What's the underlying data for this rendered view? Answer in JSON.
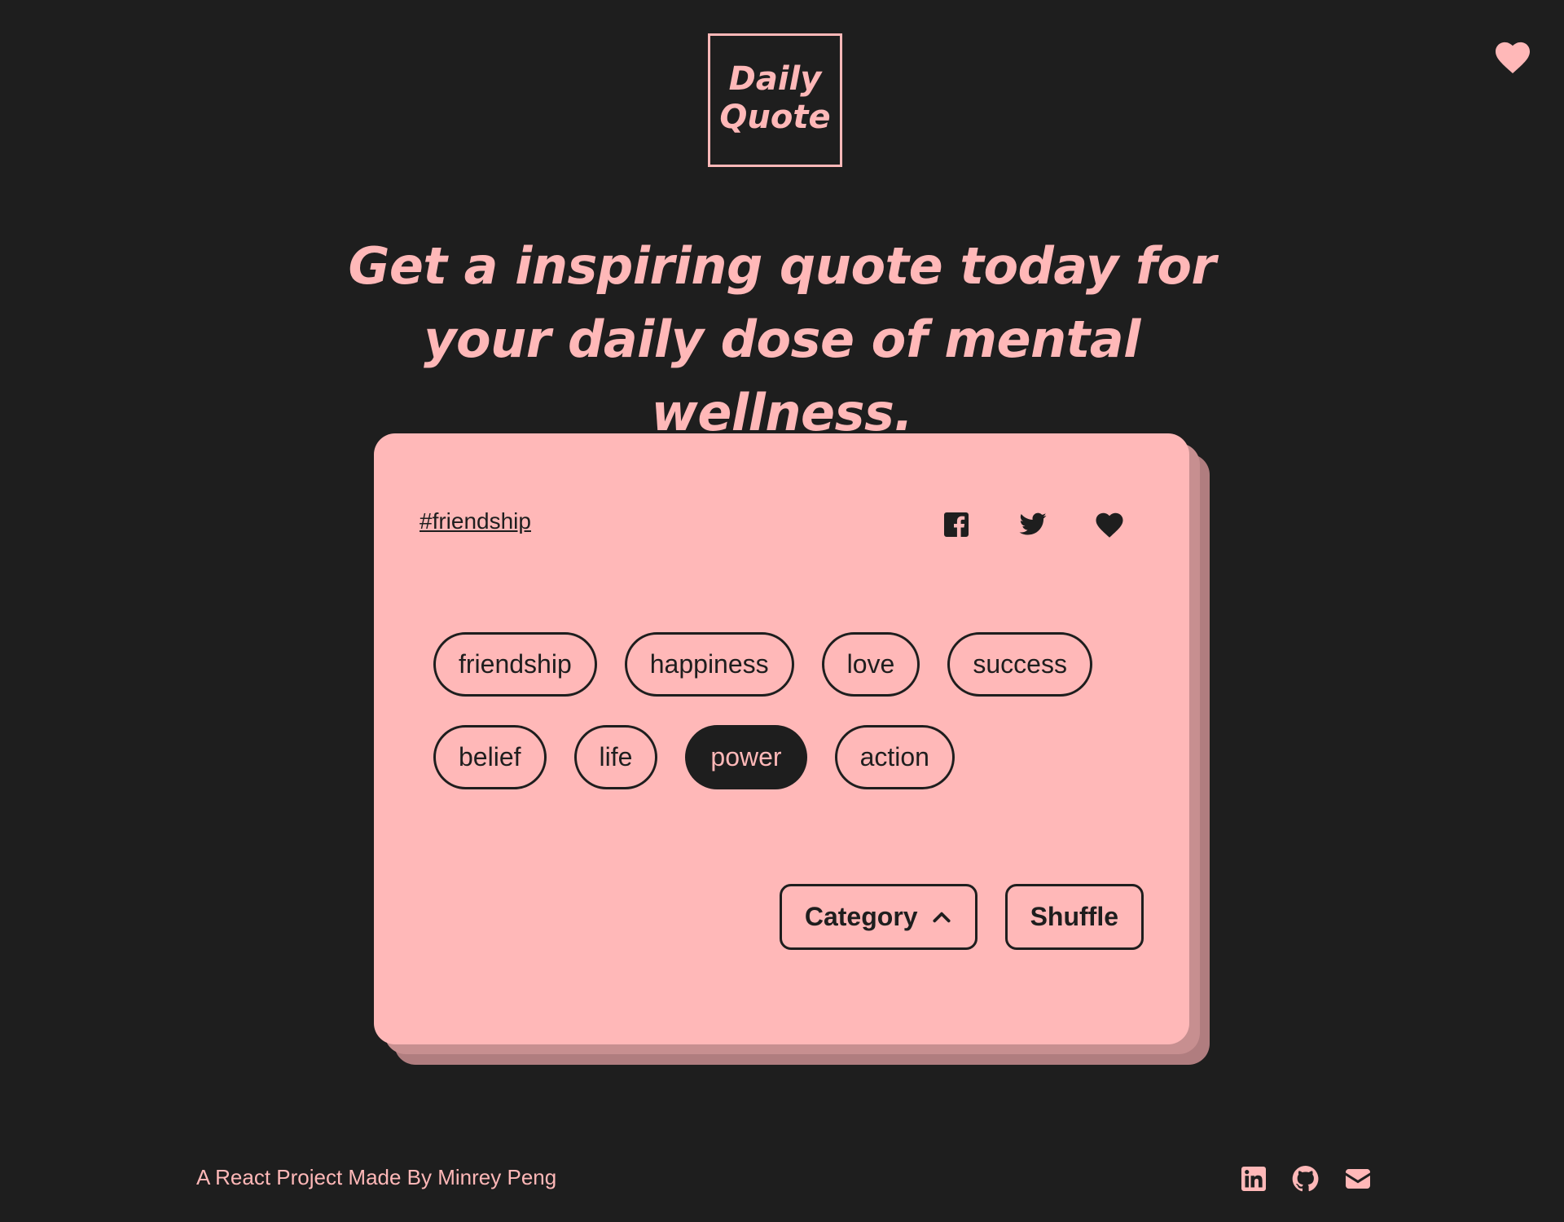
{
  "header": {
    "logo_text": "Daily\nQuote",
    "favorites_icon": "heart-icon"
  },
  "hero": {
    "headline": "Get a inspiring quote today for your daily dose of mental wellness."
  },
  "card": {
    "current_tag": "#friendship",
    "share_icons": [
      "facebook-icon",
      "twitter-icon",
      "heart-icon"
    ],
    "categories": [
      {
        "label": "friendship",
        "selected": false
      },
      {
        "label": "happiness",
        "selected": false
      },
      {
        "label": "love",
        "selected": false
      },
      {
        "label": "success",
        "selected": false
      },
      {
        "label": "belief",
        "selected": false
      },
      {
        "label": "life",
        "selected": false
      },
      {
        "label": "power",
        "selected": true
      },
      {
        "label": "action",
        "selected": false
      }
    ],
    "category_button_label": "Category",
    "category_button_icon": "chevron-up-icon",
    "shuffle_button_label": "Shuffle"
  },
  "footer": {
    "credit": "A React Project Made By Minrey Peng",
    "icons": [
      "linkedin-icon",
      "github-icon",
      "email-icon"
    ]
  },
  "colors": {
    "background": "#1e1e1e",
    "accent": "#ffb8b8",
    "card": "#ffb8b8",
    "card_shadow_1": "#c78f90",
    "card_shadow_2": "#b07d7f",
    "dark": "#1e1e1e"
  }
}
